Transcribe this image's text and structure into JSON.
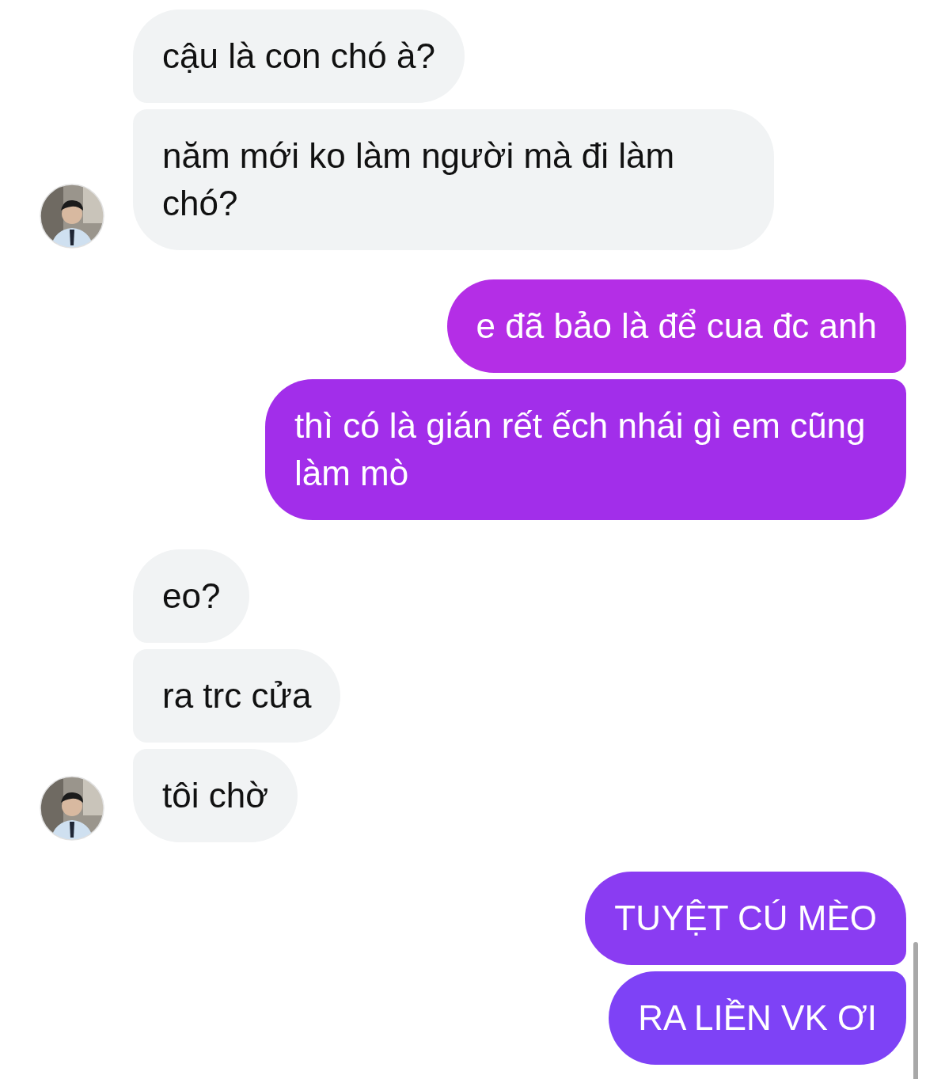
{
  "messages": [
    {
      "kind": "incoming",
      "text": "cậu là con chó à?",
      "avatar": false
    },
    {
      "kind": "incoming",
      "text": "năm mới ko làm người mà đi làm chó?",
      "avatar": true
    },
    {
      "kind": "outgoing",
      "text": "e đã bảo là để cua đc anh",
      "color": "#b42ee6"
    },
    {
      "kind": "outgoing",
      "text": "thì có là gián rết ếch nhái gì em cũng làm mò",
      "color": "#a22eea"
    },
    {
      "kind": "incoming",
      "text": "eo?",
      "avatar": false
    },
    {
      "kind": "incoming",
      "text": "ra trc cửa",
      "avatar": false
    },
    {
      "kind": "incoming",
      "text": "tôi chờ",
      "avatar": true
    },
    {
      "kind": "outgoing",
      "text": "TUYỆT CÚ MÈO",
      "color": "#8a3cf2"
    },
    {
      "kind": "outgoing",
      "text": "RA LIỀN VK ƠI",
      "color": "#7e42f6"
    }
  ]
}
